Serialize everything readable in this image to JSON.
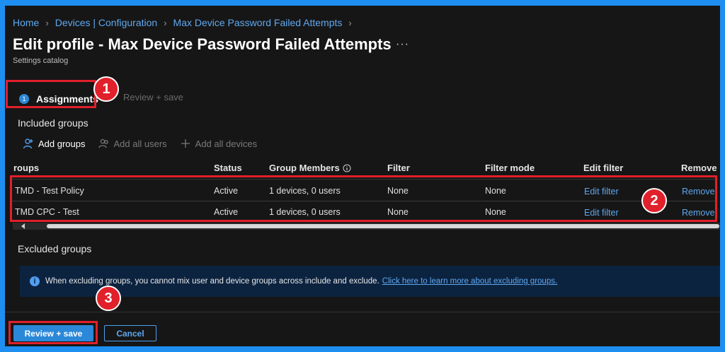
{
  "breadcrumb": [
    "Home",
    "Devices | Configuration",
    "Max Device Password Failed Attempts"
  ],
  "page": {
    "title": "Edit profile - Max Device Password Failed Attempts",
    "more": "···",
    "subtitle": "Settings catalog"
  },
  "steps": [
    {
      "number": "1",
      "label": "Assignments"
    },
    {
      "label": "Review + save"
    }
  ],
  "annotations": [
    "1",
    "2",
    "3"
  ],
  "included": {
    "title": "Included groups",
    "toolbar": {
      "add_groups": "Add groups",
      "add_all_users": "Add all users",
      "add_all_devices": "Add all devices"
    },
    "columns": [
      "roups",
      "Status",
      "Group Members",
      "Filter",
      "Filter mode",
      "Edit filter",
      "Remove"
    ],
    "rows": [
      {
        "group": "TMD - Test Policy",
        "status": "Active",
        "members": "1 devices, 0 users",
        "filter": "None",
        "filter_mode": "None",
        "edit": "Edit filter",
        "remove": "Remove"
      },
      {
        "group": "TMD CPC - Test",
        "status": "Active",
        "members": "1 devices, 0 users",
        "filter": "None",
        "filter_mode": "None",
        "edit": "Edit filter",
        "remove": "Remove"
      }
    ]
  },
  "excluded": {
    "title": "Excluded groups",
    "info_text": "When excluding groups, you cannot mix user and device groups across include and exclude.",
    "info_link": "Click here to learn more about excluding groups."
  },
  "footer": {
    "primary": "Review + save",
    "secondary": "Cancel"
  },
  "colors": {
    "accent": "#2b88d8",
    "link": "#5fa8ef",
    "annotation": "#e0202a",
    "frame": "#1e8ff0"
  }
}
